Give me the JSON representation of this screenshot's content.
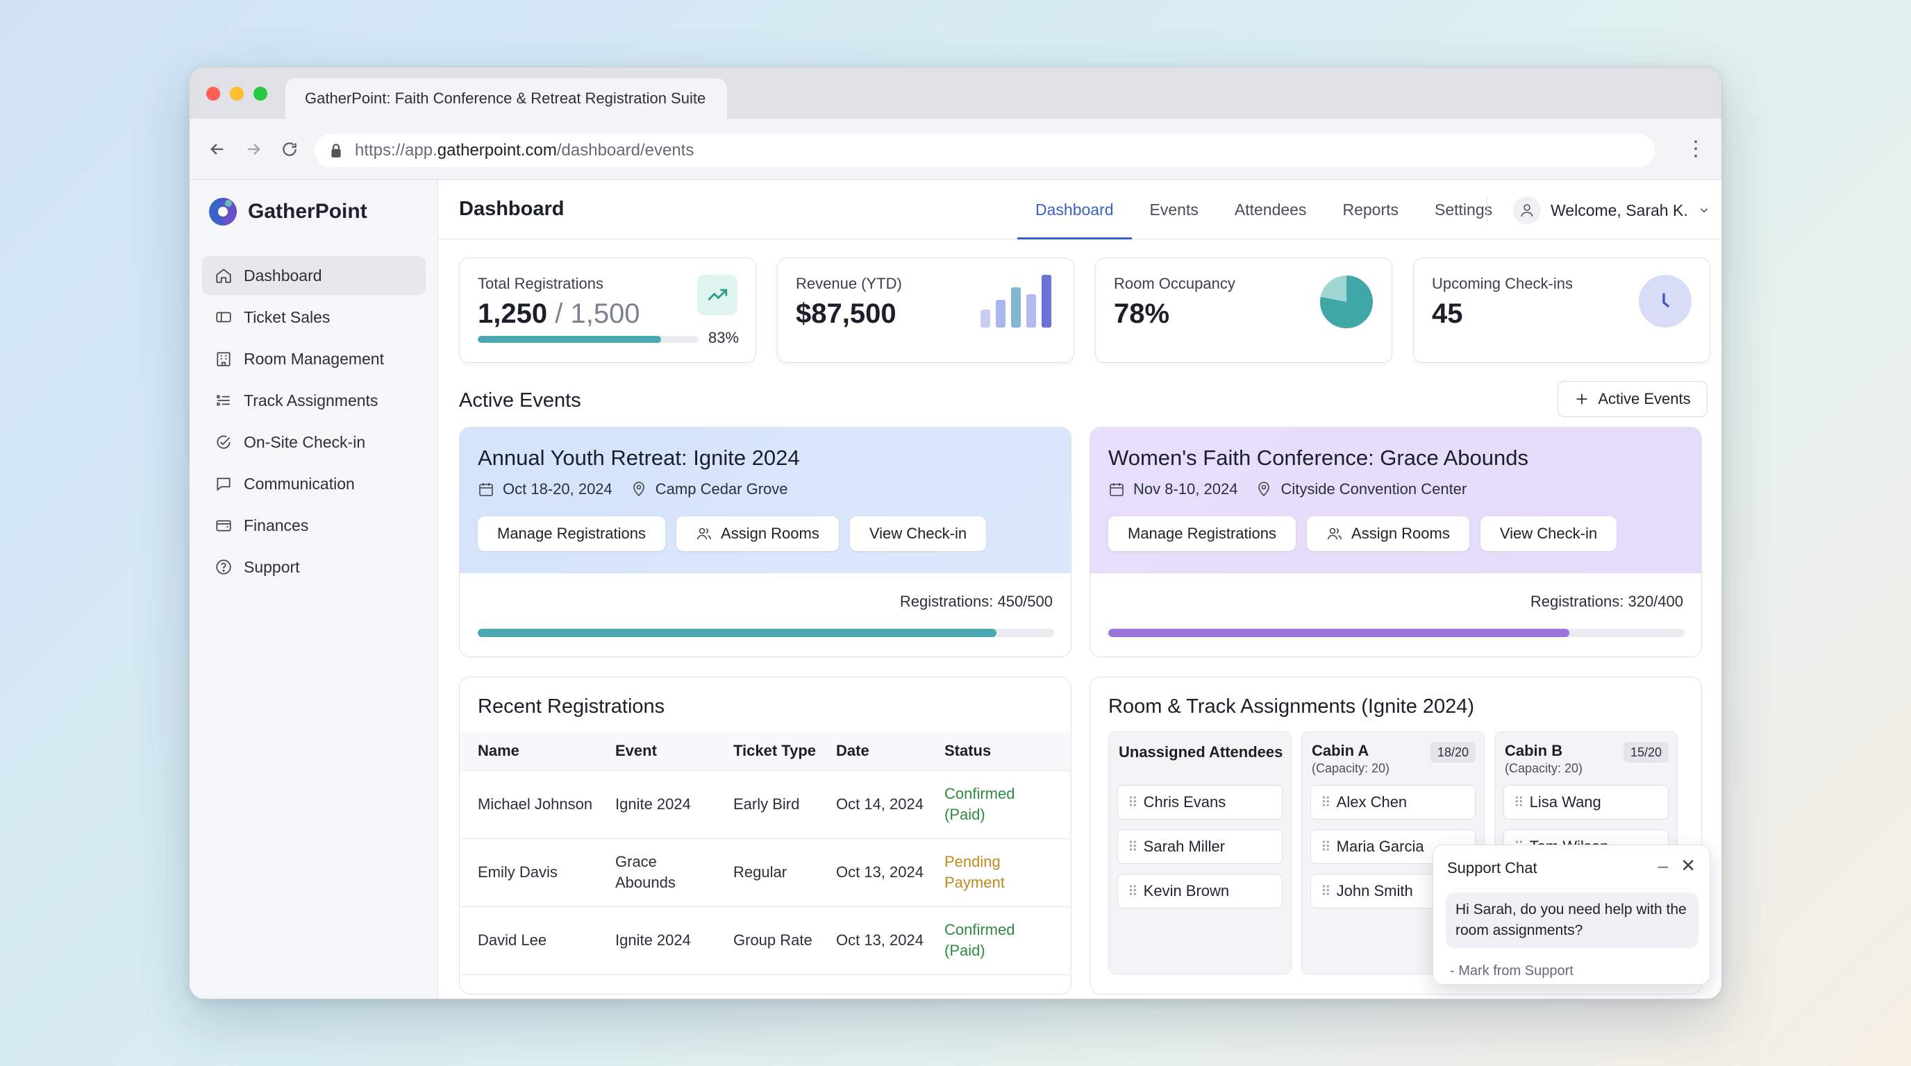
{
  "browser": {
    "tab_title": "GatherPoint: Faith Conference & Retreat Registration Suite",
    "url_prefix": "https://app.",
    "url_host": "gatherpoint.com",
    "url_path": "/dashboard/events"
  },
  "sidebar": {
    "brand": "GatherPoint",
    "items": [
      {
        "label": "Dashboard",
        "icon": "home-icon"
      },
      {
        "label": "Ticket Sales",
        "icon": "ticket-icon"
      },
      {
        "label": "Room Management",
        "icon": "building-icon"
      },
      {
        "label": "Track Assignments",
        "icon": "list-icon"
      },
      {
        "label": "On-Site Check-in",
        "icon": "check-circle-icon"
      },
      {
        "label": "Communication",
        "icon": "chat-icon"
      },
      {
        "label": "Finances",
        "icon": "wallet-icon"
      },
      {
        "label": "Support",
        "icon": "help-icon"
      }
    ]
  },
  "header": {
    "title": "Dashboard",
    "tabs": [
      "Dashboard",
      "Events",
      "Attendees",
      "Reports",
      "Settings"
    ],
    "welcome": "Welcome, Sarah K."
  },
  "stats": {
    "registrations": {
      "label": "Total Registrations",
      "current": "1,250",
      "separator": " / ",
      "total": "1,500",
      "percent_label": "83%",
      "progress": 0.83
    },
    "revenue": {
      "label": "Revenue (YTD)",
      "value": "$87,500"
    },
    "occupancy": {
      "label": "Room Occupancy",
      "value": "78%",
      "fraction": 0.78
    },
    "checkins": {
      "label": "Upcoming Check-ins",
      "value": "45"
    }
  },
  "active_events": {
    "heading": "Active Events",
    "add_button": "Active Events",
    "events": [
      {
        "title": "Annual Youth Retreat: Ignite 2024",
        "dates": "Oct 18-20, 2024",
        "location": "Camp Cedar Grove",
        "actions": [
          "Manage Registrations",
          "Assign Rooms",
          "View Check-in"
        ],
        "registrations_label": "Registrations: 450/500",
        "progress": 0.9,
        "accent": "#4aa9b0"
      },
      {
        "title": "Women's Faith Conference: Grace Abounds",
        "dates": "Nov 8-10, 2024",
        "location": "Cityside Convention Center",
        "actions": [
          "Manage Registrations",
          "Assign Rooms",
          "View Check-in"
        ],
        "registrations_label": "Registrations: 320/400",
        "progress": 0.8,
        "accent": "#9a74dc"
      }
    ]
  },
  "recent_registrations": {
    "title": "Recent Registrations",
    "columns": [
      "Name",
      "Event",
      "Ticket Type",
      "Date",
      "Status"
    ],
    "rows": [
      {
        "name": "Michael Johnson",
        "event": "Ignite 2024",
        "ticket": "Early Bird",
        "date": "Oct 14, 2024",
        "status_1": "Confirmed",
        "status_2": "(Paid)"
      },
      {
        "name": "Emily Davis",
        "event": "Grace Abounds",
        "ticket": "Regular",
        "date": "Oct 13, 2024",
        "status_1": "Pending",
        "status_2": "Payment"
      },
      {
        "name": "David Lee",
        "event": "Ignite 2024",
        "ticket": "Group Rate",
        "date": "Oct 13, 2024",
        "status_1": "Confirmed",
        "status_2": "(Paid)"
      }
    ]
  },
  "room_track": {
    "title": "Room & Track Assignments (Ignite 2024)",
    "unassigned": {
      "label": "Unassigned Attendees",
      "people": [
        "Chris Evans",
        "Sarah Miller",
        "Kevin Brown"
      ]
    },
    "cabin_a": {
      "label": "Cabin A",
      "capacity": "(Capacity: 20)",
      "count": "18/20",
      "people": [
        "Alex Chen",
        "Maria Garcia",
        "John Smith"
      ]
    },
    "cabin_b": {
      "label": "Cabin B",
      "capacity": "(Capacity: 20)",
      "count": "15/20",
      "people": [
        "Lisa Wang",
        "Tom Wilson"
      ]
    }
  },
  "support_chat": {
    "title": "Support Chat",
    "message": "Hi Sarah, do you need help with the room assignments?",
    "from": "- Mark from Support"
  }
}
